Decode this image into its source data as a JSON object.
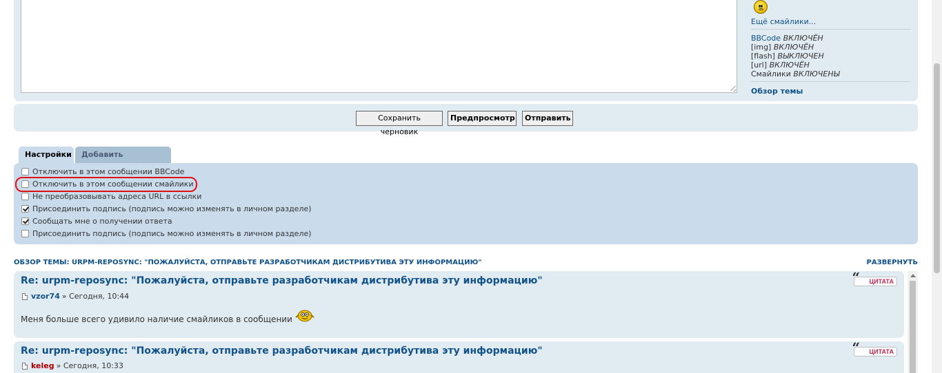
{
  "sidebar": {
    "more_smileys": "Ещё смайлики...",
    "status": [
      {
        "name": "BBCode",
        "value": "ВКЛЮЧЁН",
        "is_link": true
      },
      {
        "name": "[img]",
        "value": "ВКЛЮЧЁН",
        "is_link": false
      },
      {
        "name": "[flash]",
        "value": "ВЫКЛЮЧЕН",
        "is_link": false
      },
      {
        "name": "[url]",
        "value": "ВКЛЮЧЁН",
        "is_link": false
      },
      {
        "name": "Смайлики",
        "value": "ВКЛЮЧЕНЫ",
        "is_link": false
      }
    ],
    "topic_review": "Обзор темы"
  },
  "buttons": {
    "save_draft": "Сохранить черновик",
    "preview": "Предпросмотр",
    "submit": "Отправить"
  },
  "tabs": [
    {
      "label": "Настройки",
      "active": true
    },
    {
      "label": "Добавить вложения",
      "active": false
    }
  ],
  "options": [
    {
      "label": "Отключить в этом сообщении BBCode",
      "checked": false
    },
    {
      "label": "Отключить в этом сообщении смайлики",
      "checked": false,
      "highlighted": true
    },
    {
      "label": "Не преобразовывать адреса URL в ссылки",
      "checked": false
    },
    {
      "label": "Присоединить подпись (подпись можно изменять в личном разделе)",
      "checked": true
    },
    {
      "label": "Сообщать мне о получении ответа",
      "checked": true
    },
    {
      "label": "Присоединить подпись (подпись можно изменять в личном разделе)",
      "checked": false
    }
  ],
  "review": {
    "header": "Обзор темы: urpm-reposync: \"Пожалуйста, отправьте разработчикам дистрибутива эту информацию\"",
    "expand": "РАЗВЕРНУТЬ",
    "quote_label": "ЦИТАТА",
    "separator": "»",
    "posts": [
      {
        "title": "Re: urpm-reposync: \"Пожалуйста, отправьте разработчикам дистрибутива эту информацию\"",
        "author": "vzor74",
        "time": "Сегодня, 10:44",
        "body": "Меня больше всего удивило наличие смайликов в сообщении"
      },
      {
        "title": "Re: urpm-reposync: \"Пожалуйста, отправьте разработчикам дистрибутива эту информацию\"",
        "author": "keleg",
        "time": "Сегодня, 10:33",
        "body": ""
      }
    ]
  },
  "colors": {
    "panel_bg": "#e1ebf2",
    "options_bg": "#cadceb",
    "link": "#105289",
    "highlight": "#e01010",
    "author2": "#aa0000"
  }
}
